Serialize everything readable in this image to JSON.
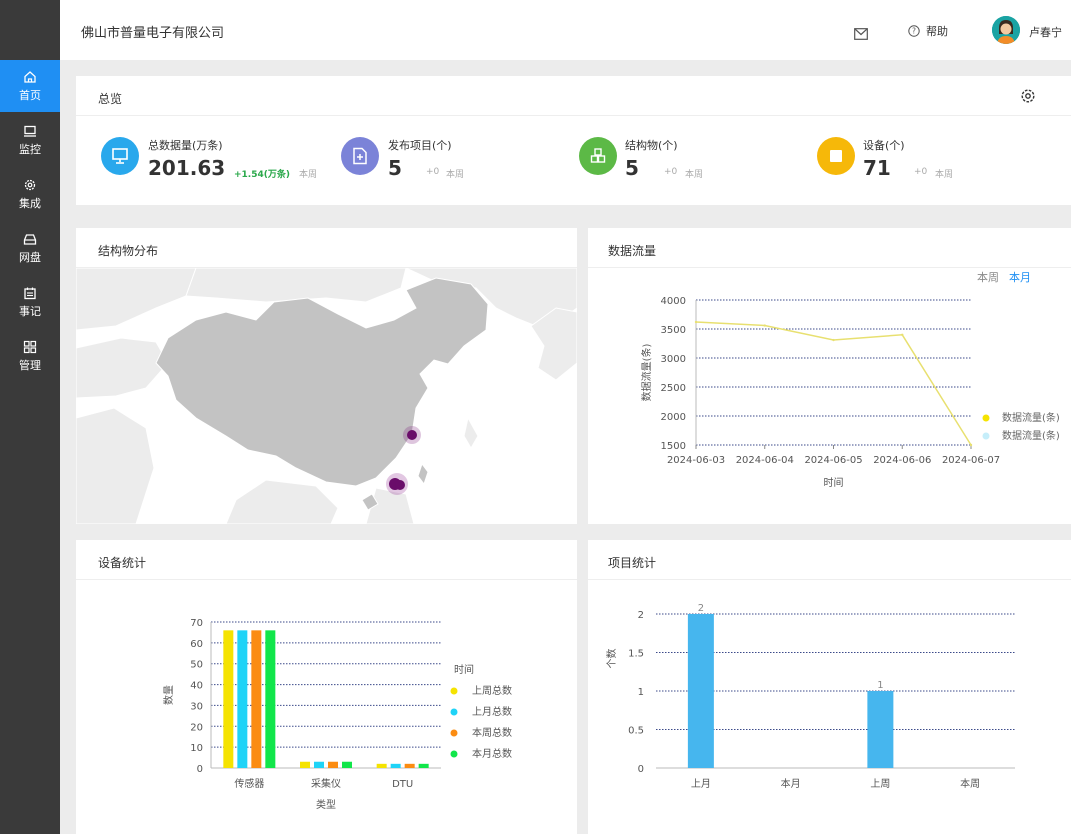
{
  "header": {
    "company": "佛山市普量电子有限公司",
    "help_label": "帮助",
    "username": "卢春宁"
  },
  "sidebar": {
    "items": [
      {
        "label": "首页",
        "icon": "home-icon",
        "active": true
      },
      {
        "label": "监控",
        "icon": "monitor-icon",
        "active": false
      },
      {
        "label": "集成",
        "icon": "gear-icon",
        "active": false
      },
      {
        "label": "网盘",
        "icon": "drive-icon",
        "active": false
      },
      {
        "label": "事记",
        "icon": "calendar-icon",
        "active": false
      },
      {
        "label": "管理",
        "icon": "grid-icon",
        "active": false
      }
    ]
  },
  "overview": {
    "title": "总览",
    "stats": [
      {
        "label": "总数据量(万条)",
        "value": "201.63",
        "delta": "+1.54(万条)",
        "period": "本周",
        "color": "#29a8ec",
        "icon": "monitor-icon"
      },
      {
        "label": "发布项目(个)",
        "value": "5",
        "delta": "+0",
        "period": "本周",
        "color": "#7b83d8",
        "icon": "document-add-icon"
      },
      {
        "label": "结构物(个)",
        "value": "5",
        "delta": "+0",
        "period": "本周",
        "color": "#5cb946",
        "icon": "cubes-icon"
      },
      {
        "label": "设备(个)",
        "value": "71",
        "delta": "+0",
        "period": "本周",
        "color": "#f6b809",
        "icon": "device-icon"
      }
    ]
  },
  "structure_map": {
    "title": "结构物分布"
  },
  "data_flow": {
    "title": "数据流量",
    "toggle_week": "本周",
    "toggle_month": "本月"
  },
  "device_stats": {
    "title": "设备统计"
  },
  "project_stats": {
    "title": "项目统计"
  },
  "chart_data": [
    {
      "type": "line",
      "title": "数据流量",
      "x": [
        "2024-06-03",
        "2024-06-04",
        "2024-06-05",
        "2024-06-06",
        "2024-06-07"
      ],
      "series": [
        {
          "name": "数据流量(条)",
          "values": [
            3620,
            3560,
            3310,
            3400,
            1500
          ],
          "color": "#e8e070"
        },
        {
          "name": "数据流量(条)",
          "values": [],
          "color": "#c6eefa"
        }
      ],
      "xlabel": "时间",
      "ylabel": "数据流量(条)",
      "yticks": [
        1500,
        2000,
        2500,
        3000,
        3500,
        4000
      ],
      "ylim": [
        1500,
        4000
      ],
      "legend": "bottom-right",
      "grid": true
    },
    {
      "type": "bar",
      "title": "设备统计",
      "categories": [
        "传感器",
        "采集仪",
        "DTU"
      ],
      "series": [
        {
          "name": "上周总数",
          "values": [
            66,
            3,
            2
          ],
          "color": "#f5e301"
        },
        {
          "name": "上月总数",
          "values": [
            66,
            3,
            2
          ],
          "color": "#1fd3f7"
        },
        {
          "name": "本周总数",
          "values": [
            66,
            3,
            2
          ],
          "color": "#fb8c12"
        },
        {
          "name": "本月总数",
          "values": [
            66,
            3,
            2
          ],
          "color": "#11e64a"
        }
      ],
      "legend_title": "时间",
      "xlabel": "类型",
      "ylabel": "数量",
      "yticks": [
        0,
        10,
        20,
        30,
        40,
        50,
        60,
        70
      ],
      "ylim": [
        0,
        70
      ],
      "legend": "right",
      "grid": true
    },
    {
      "type": "bar",
      "title": "项目统计",
      "categories": [
        "上月",
        "本月",
        "上周",
        "本周"
      ],
      "values": [
        2,
        0,
        1,
        0
      ],
      "value_labels": [
        "2",
        "",
        "1",
        ""
      ],
      "ylabel": "个数",
      "yticks": [
        "0",
        "0.5",
        "1",
        "1.5",
        "2"
      ],
      "ylim": [
        0,
        2
      ],
      "color": "#46b6ee",
      "grid": true
    }
  ]
}
